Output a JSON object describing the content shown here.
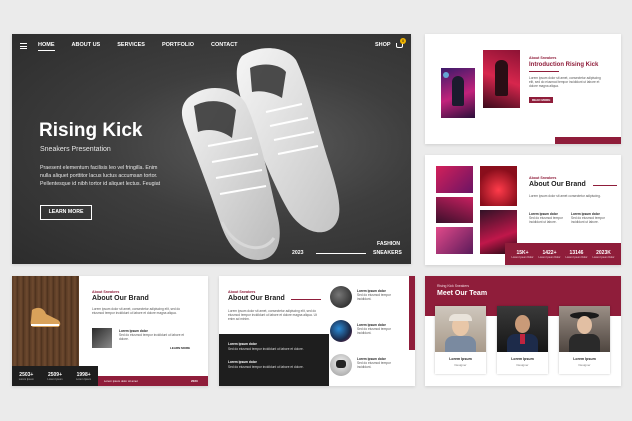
{
  "hero": {
    "nav": [
      "HOME",
      "ABOUT US",
      "SERVICES",
      "PORTFOLIO",
      "CONTACT"
    ],
    "shop": "SHOP",
    "cart_count": "0",
    "title": "Rising Kick",
    "subtitle": "Sneakers Presentation",
    "body": "Praesent elementum facilisis leo vel fringilla. Enim nulla aliquet porttitor lacus luctus accumsan tortor. Pellentesque id nibh tortor id aliquet lectus. Feugiat",
    "cta": "LEARN MORE",
    "year": "2023",
    "tag1": "FASHION",
    "tag2": "SNEAKERS"
  },
  "intro": {
    "kicker": "About Sneakers",
    "title": "Introduction Rising Kick",
    "text": "Lorem ipsum dolor sit amet, consectetur adipiscing elit, sed do eiusmod tempor incididunt ut labore et dolore magna aliqua.",
    "button": "READ MORE"
  },
  "brand_right": {
    "kicker": "About Sneakers",
    "title": "About Our Brand",
    "text": "Lorem ipsum dolor sit amet consectetur adipiscing.",
    "col1_head": "Lorem ipsum dolor",
    "col2_head": "Lorem ipsum dolor",
    "col_text": "Sed do eiusmod tempor incididunt ut labore.",
    "stats": [
      {
        "value": "15K+",
        "label": "Lorem Ipsum Dolor"
      },
      {
        "value": "1422+",
        "label": "Lorem Ipsum Dolor"
      },
      {
        "value": "13146",
        "label": "Lorem Ipsum Dolor"
      },
      {
        "value": "2023K",
        "label": "Lorem Ipsum Dolor"
      }
    ]
  },
  "brand_left": {
    "kicker": "About Sneakers",
    "title": "About Our Brand",
    "text": "Lorem ipsum dolor sit amet, consectetur adipiscing elit, sed do eiusmod tempor incididunt ut labore et dolore magna aliqua.",
    "item_head": "Lorem ipsum dolor",
    "item_text": "Sed do eiusmod tempor incididunt ut labore et dolore.",
    "link": "LEARN MORE",
    "stats": [
      {
        "value": "2503+",
        "label": "Lorem Ipsum"
      },
      {
        "value": "2509+",
        "label": "Lorem Ipsum"
      },
      {
        "value": "1998+",
        "label": "Lorem Ipsum"
      }
    ],
    "bar_text": "Lorem ipsum dolor sit amet",
    "bar_year": "2023"
  },
  "brand_mid": {
    "kicker": "About Sneakers",
    "title": "About Our Brand",
    "text": "Lorem ipsum dolor sit amet, consectetur adipiscing elit, sed do eiusmod tempor incididunt ut labore et dolore magna aliqua. Ut enim ad minim.",
    "dark_head1": "Lorem ipsum dolor",
    "dark_head2": "Lorem ipsum dolor",
    "dark_text": "Sed do eiusmod tempor incididunt ut labore et dolore.",
    "items": [
      {
        "head": "Lorem ipsum dolor",
        "text": "Sed do eiusmod tempor incididunt."
      },
      {
        "head": "Lorem ipsum dolor",
        "text": "Sed do eiusmod tempor incididunt."
      },
      {
        "head": "Lorem ipsum dolor",
        "text": "Sed do eiusmod tempor incididunt."
      }
    ]
  },
  "team": {
    "kicker": "Rising Kick Sneakers",
    "title": "Meet Our Team",
    "members": [
      {
        "name": "Lorem Ipsum",
        "role": "Designer"
      },
      {
        "name": "Lorem Ipsum",
        "role": "Designer"
      },
      {
        "name": "Lorem Ipsum",
        "role": "Designer"
      }
    ]
  },
  "colors": {
    "accent": "#8f1d3a",
    "dark": "#1d1d1d",
    "bg": "#ebebeb",
    "gold": "#f0b400"
  }
}
